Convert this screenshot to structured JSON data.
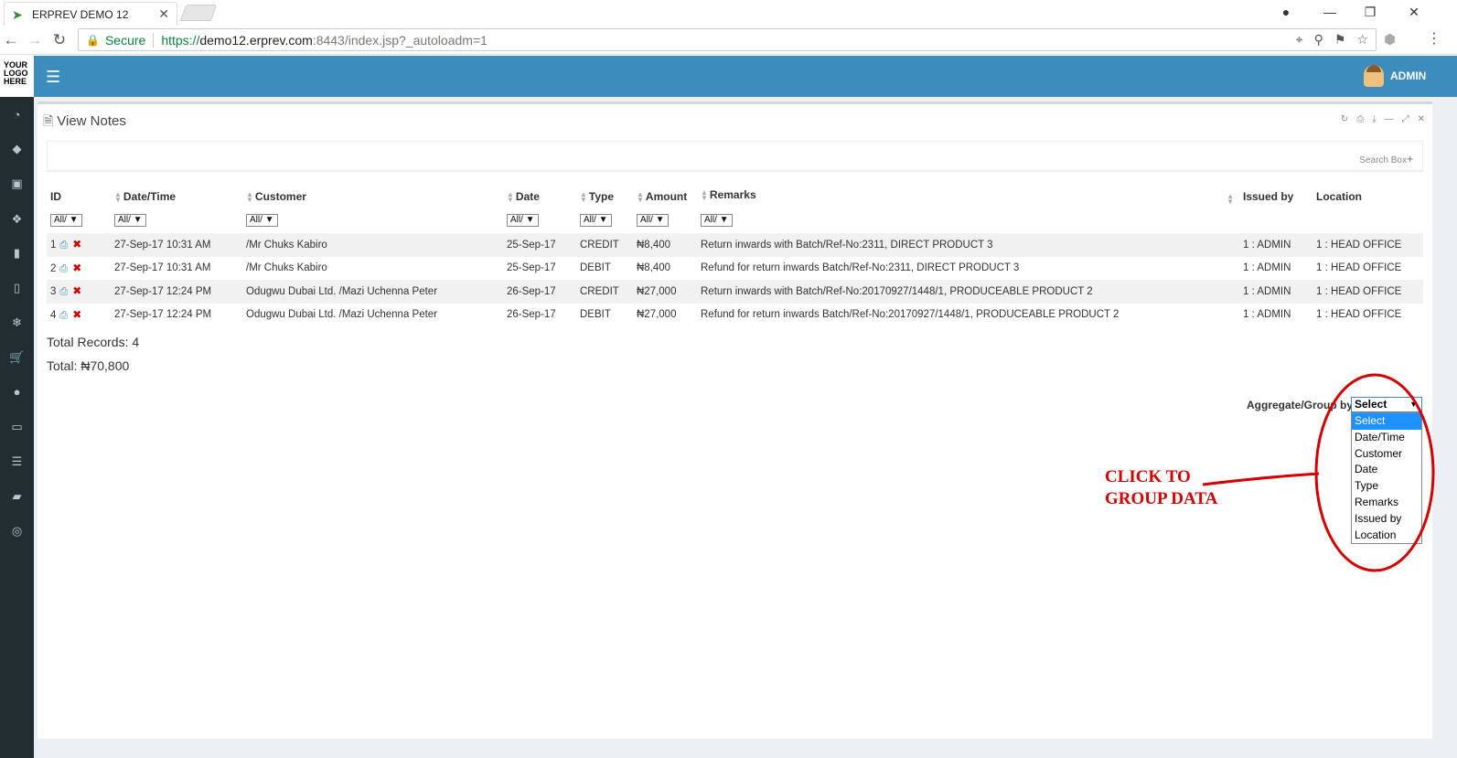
{
  "browser": {
    "tab_title": "ERPREV DEMO 12",
    "secure_label": "Secure",
    "url_scheme": "https://",
    "url_host": "demo12.erprev.com",
    "url_path": ":8443/index.jsp?_autoloadm=1"
  },
  "app": {
    "logo": [
      "YOUR",
      "LOGO",
      "HERE"
    ],
    "user_name": "ADMIN",
    "accent_color": "#3c8dbc",
    "sidebar_color": "#222d32",
    "sidebar_icons": [
      "dashboard-icon",
      "tag-icon",
      "money-icon",
      "cubes-icon",
      "building-icon",
      "trash-icon",
      "snowflake-icon",
      "cart-icon",
      "circle-icon",
      "desktop-icon",
      "database-icon",
      "book-icon",
      "lifebuoy-icon"
    ]
  },
  "box": {
    "title": "View Notes",
    "search_label": "Search Box"
  },
  "table": {
    "columns": [
      "ID",
      "Date/Time",
      "Customer",
      "Date",
      "Type",
      "Amount",
      "Remarks",
      "Issued by",
      "Location"
    ],
    "filter_label": "All/",
    "rows": [
      {
        "id": "1",
        "datetime": "27-Sep-17 10:31 AM",
        "customer": "/Mr Chuks Kabiro",
        "date": "25-Sep-17",
        "type": "CREDIT",
        "amount": "₦8,400",
        "remarks": "Return inwards with Batch/Ref-No:2311, DIRECT PRODUCT 3",
        "issued_by": "1 : ADMIN",
        "location": "1 : HEAD OFFICE"
      },
      {
        "id": "2",
        "datetime": "27-Sep-17 10:31 AM",
        "customer": "/Mr Chuks Kabiro",
        "date": "25-Sep-17",
        "type": "DEBIT",
        "amount": "₦8,400",
        "remarks": "Refund for return inwards Batch/Ref-No:2311, DIRECT PRODUCT 3",
        "issued_by": "1 : ADMIN",
        "location": "1 : HEAD OFFICE"
      },
      {
        "id": "3",
        "datetime": "27-Sep-17 12:24 PM",
        "customer": "Odugwu Dubai Ltd. /Mazi Uchenna Peter",
        "date": "26-Sep-17",
        "type": "CREDIT",
        "amount": "₦27,000",
        "remarks": "Return inwards with Batch/Ref-No:20170927/1448/1, PRODUCEABLE PRODUCT 2",
        "issued_by": "1 : ADMIN",
        "location": "1 : HEAD OFFICE"
      },
      {
        "id": "4",
        "datetime": "27-Sep-17 12:24 PM",
        "customer": "Odugwu Dubai Ltd. /Mazi Uchenna Peter",
        "date": "26-Sep-17",
        "type": "DEBIT",
        "amount": "₦27,000",
        "remarks": "Refund for return inwards Batch/Ref-No:20170927/1448/1, PRODUCEABLE PRODUCT 2",
        "issued_by": "1 : ADMIN",
        "location": "1 : HEAD OFFICE"
      }
    ]
  },
  "totals": {
    "records": "Total Records: 4",
    "amount": "Total: ₦70,800"
  },
  "aggregate": {
    "label": "Aggregate/Group by:",
    "selected": "Select",
    "options": [
      "Select",
      "Date/Time",
      "Customer",
      "Date",
      "Type",
      "Remarks",
      "Issued by",
      "Location"
    ]
  },
  "annotation": {
    "line1": "CLICK TO",
    "line2": "GROUP DATA",
    "color": "#d40000"
  }
}
